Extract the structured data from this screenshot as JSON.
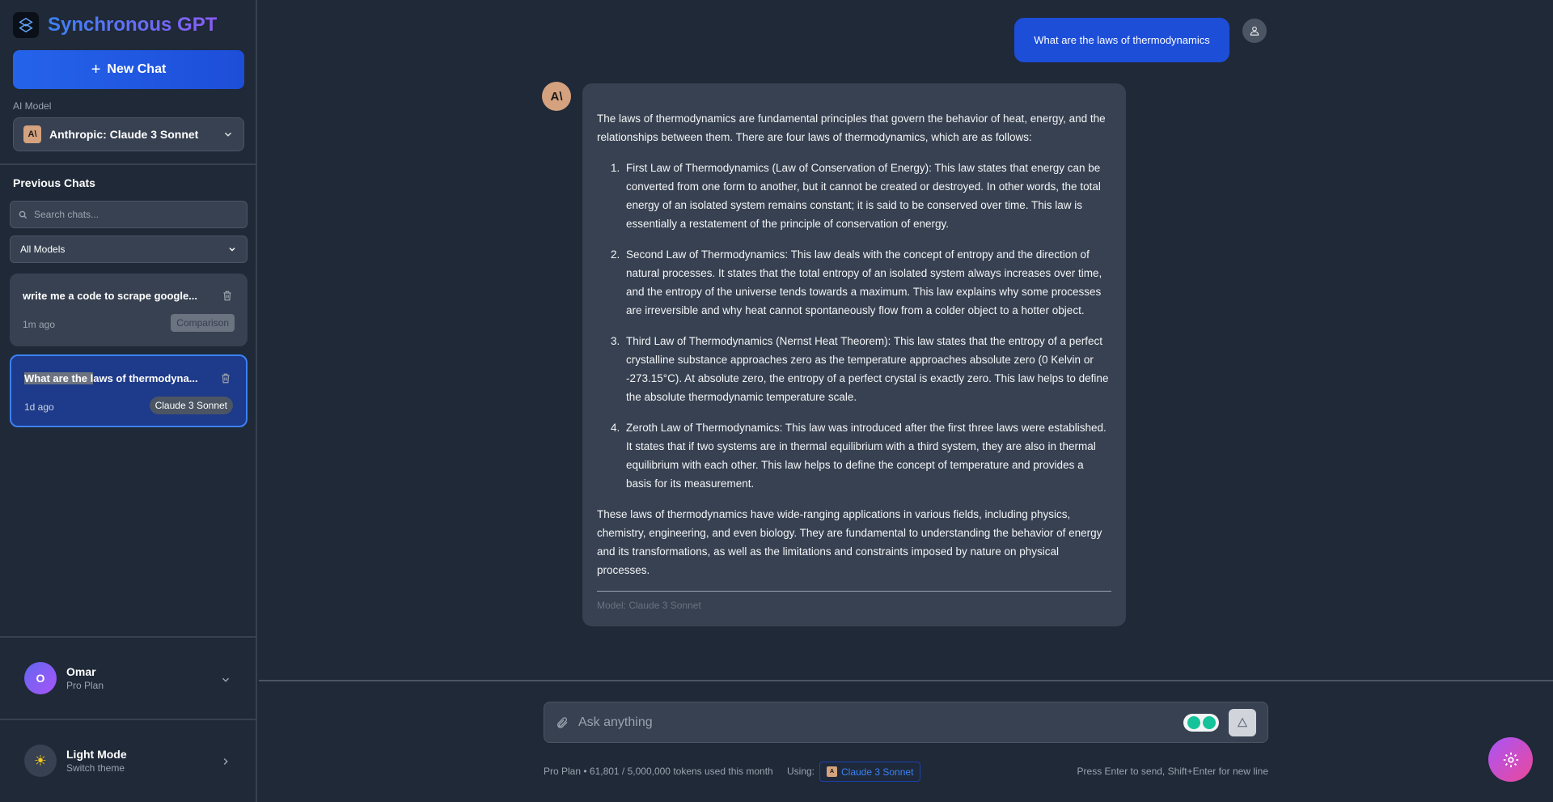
{
  "sidebar": {
    "brand": "Synchronous GPT",
    "new_chat": "New Chat",
    "model_label": "AI Model",
    "model_badge": "A\\",
    "model_name": "Anthropic: Claude 3 Sonnet",
    "previous_chats": "Previous Chats",
    "search_placeholder": "Search chats...",
    "filter_value": "All Models",
    "chats": [
      {
        "title": "write me a code to scrape google...",
        "time": "1m ago",
        "tag": "Comparison"
      },
      {
        "title_selected": "What are the l",
        "title_rest": "aws of thermodyna...",
        "time": "1d ago",
        "tag": "Claude 3 Sonnet"
      }
    ],
    "user": {
      "initial": "O",
      "name": "Omar",
      "plan": "Pro Plan"
    },
    "theme": {
      "title": "Light Mode",
      "subtitle": "Switch theme"
    }
  },
  "conversation": {
    "user_message": "What are the laws of thermodynamics",
    "bot_badge": "A\\",
    "intro": "The laws of thermodynamics are fundamental principles that govern the behavior of heat, energy, and the relationships between them. There are four laws of thermodynamics, which are as follows:",
    "laws": [
      "First Law of Thermodynamics (Law of Conservation of Energy): This law states that energy can be converted from one form to another, but it cannot be created or destroyed. In other words, the total energy of an isolated system remains constant; it is said to be conserved over time. This law is essentially a restatement of the principle of conservation of energy.",
      "Second Law of Thermodynamics: This law deals with the concept of entropy and the direction of natural processes. It states that the total entropy of an isolated system always increases over time, and the entropy of the universe tends towards a maximum. This law explains why some processes are irreversible and why heat cannot spontaneously flow from a colder object to a hotter object.",
      "Third Law of Thermodynamics (Nernst Heat Theorem): This law states that the entropy of a perfect crystalline substance approaches zero as the temperature approaches absolute zero (0 Kelvin or -273.15°C). At absolute zero, the entropy of a perfect crystal is exactly zero. This law helps to define the absolute thermodynamic temperature scale.",
      "Zeroth Law of Thermodynamics: This law was introduced after the first three laws were established. It states that if two systems are in thermal equilibrium with a third system, they are also in thermal equilibrium with each other. This law helps to define the concept of temperature and provides a basis for its measurement."
    ],
    "conclusion": "These laws of thermodynamics have wide-ranging applications in various fields, including physics, chemistry, engineering, and even biology. They are fundamental to understanding the behavior of energy and its transformations, as well as the limitations and constraints imposed by nature on physical processes.",
    "model_meta": "Model: Claude 3 Sonnet"
  },
  "composer": {
    "placeholder": "Ask anything",
    "usage": "Pro Plan • 61,801 / 5,000,000 tokens used this month",
    "using_label": "Using:",
    "using_model": "Claude 3 Sonnet",
    "hint": "Press Enter to send, Shift+Enter for new line"
  }
}
